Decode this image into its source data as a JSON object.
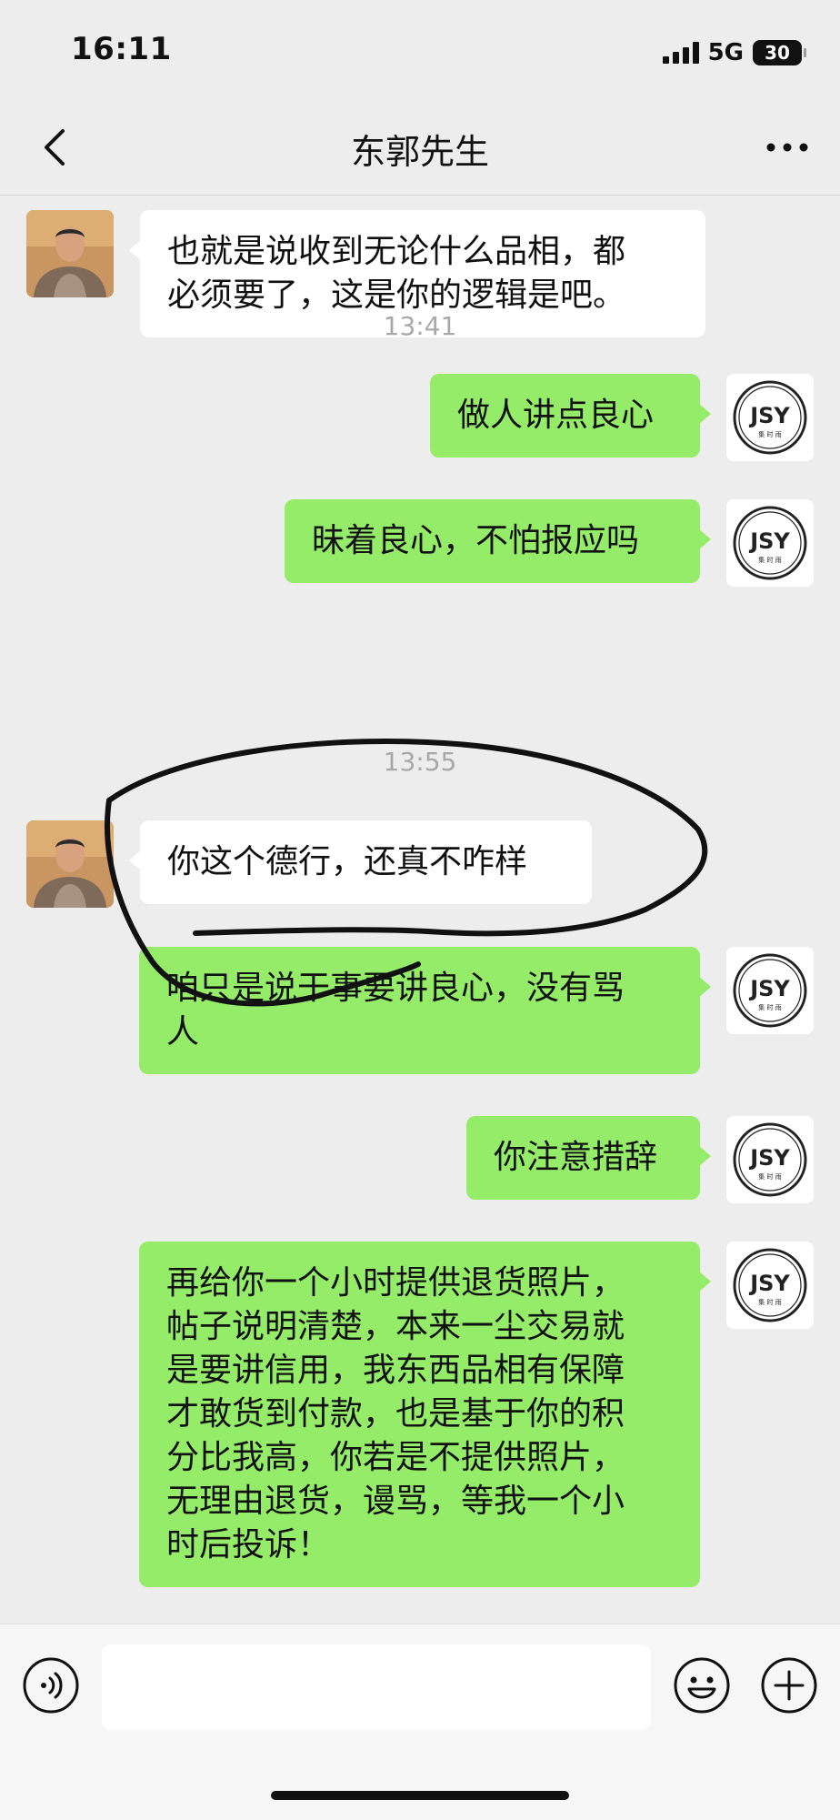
{
  "status_bar": {
    "time": "16:11",
    "network": "5G",
    "battery": "30"
  },
  "header": {
    "title": "东郭先生"
  },
  "messages": [
    {
      "side": "in",
      "text": "也就是说收到无论什么品相，都\n必须要了，这是你的逻辑是吧。"
    },
    {
      "type": "time",
      "text": "13:41"
    },
    {
      "side": "out",
      "text": "做人讲点良心"
    },
    {
      "side": "out",
      "text": "昧着良心，不怕报应吗"
    },
    {
      "type": "time",
      "text": "13:55"
    },
    {
      "side": "in",
      "text": "你这个德行，还真不咋样"
    },
    {
      "side": "out",
      "text": "咱只是说干事要讲良心，没有骂\n人"
    },
    {
      "side": "out",
      "text": "你注意措辞"
    },
    {
      "side": "out",
      "text": "再给你一个小时提供退货照片，\n帖子说明清楚，本来一尘交易就\n是要讲信用，我东西品相有保障\n才敢货到付款，也是基于你的积\n分比我高，你若是不提供照片，\n无理由退货，谩骂，等我一个小\n时后投诉！"
    }
  ],
  "logo": {
    "letters": "JSY",
    "subtext": "集 时 雨"
  },
  "input": {
    "value": "",
    "placeholder": ""
  },
  "colors": {
    "background": "#ededed",
    "outgoing_bubble": "#95ec69",
    "incoming_bubble": "#ffffff",
    "timestamp": "#a8a8a8"
  }
}
